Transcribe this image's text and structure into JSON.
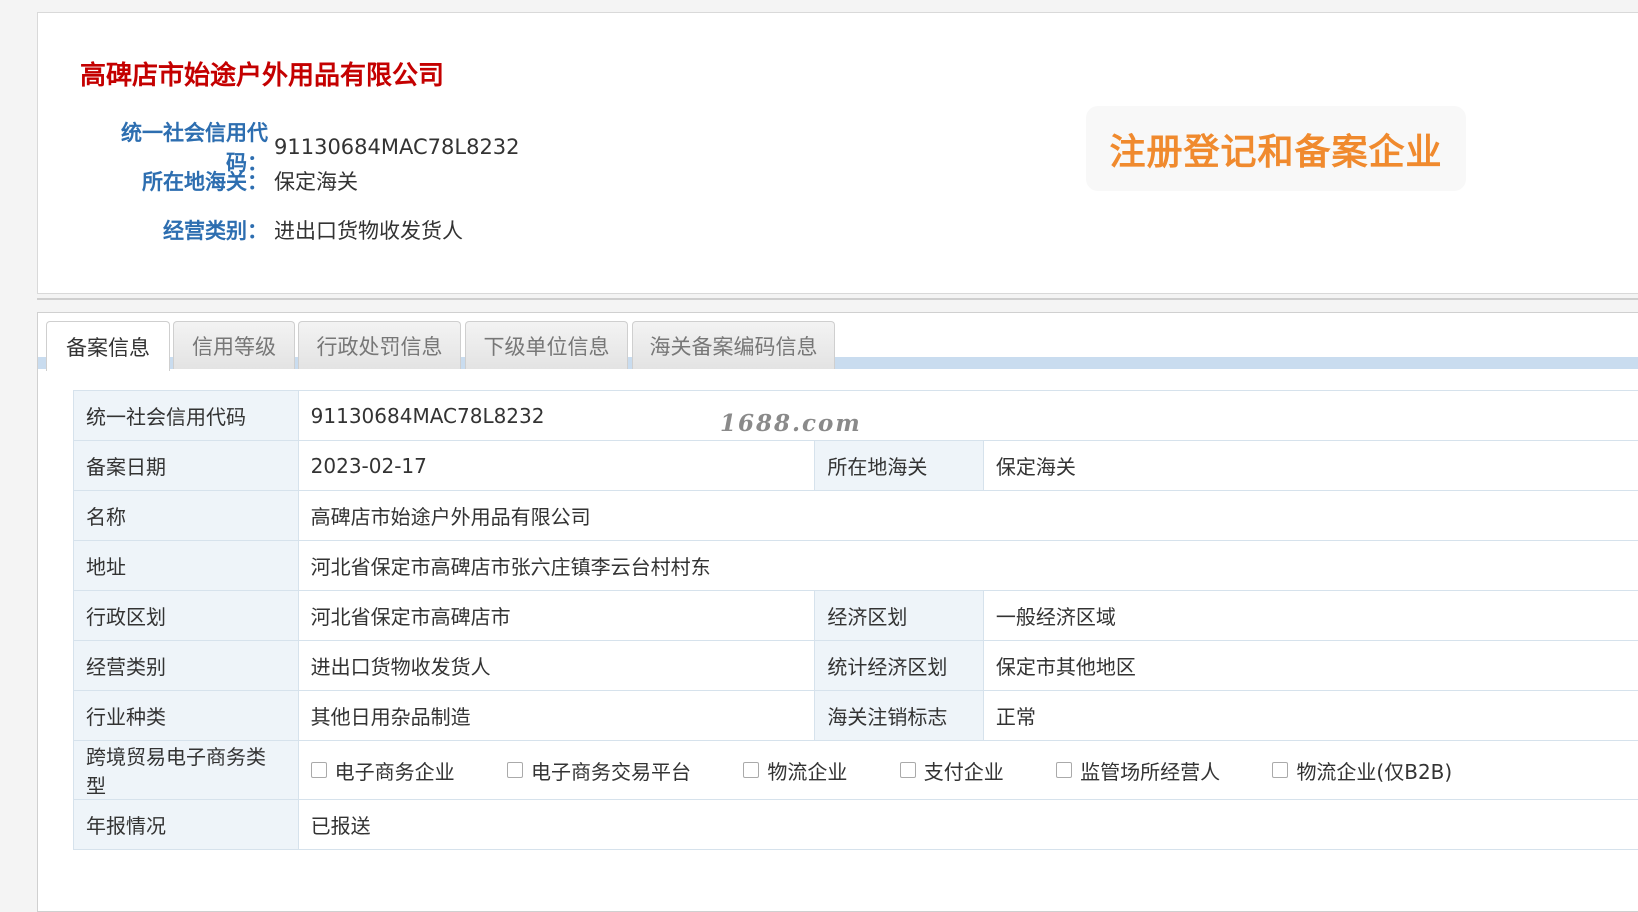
{
  "header": {
    "company_name": "高碑店市始途户外用品有限公司",
    "fields": [
      {
        "label": "统一社会信用代码：",
        "value": "91130684MAC78L8232"
      },
      {
        "label": "所在地海关：",
        "value": "保定海关"
      },
      {
        "label": "经营类别：",
        "value": "进出口货物收发货人"
      }
    ],
    "badge": "注册登记和备案企业"
  },
  "tabs": [
    "备案信息",
    "信用等级",
    "行政处罚信息",
    "下级单位信息",
    "海关备案编码信息"
  ],
  "active_tab": "备案信息",
  "watermark": "1688.com",
  "table": {
    "credit_code_label": "统一社会信用代码",
    "credit_code": "91130684MAC78L8232",
    "record_date_label": "备案日期",
    "record_date": "2023-02-17",
    "customs_label": "所在地海关",
    "customs": "保定海关",
    "name_label": "名称",
    "name": "高碑店市始途户外用品有限公司",
    "address_label": "地址",
    "address": "河北省保定市高碑店市张六庄镇李云台村村东",
    "admin_region_label": "行政区划",
    "admin_region": "河北省保定市高碑店市",
    "econ_region_label": "经济区划",
    "econ_region": "一般经济区域",
    "business_type_label": "经营类别",
    "business_type": "进出口货物收发货人",
    "stat_region_label": "统计经济区划",
    "stat_region": "保定市其他地区",
    "industry_label": "行业种类",
    "industry": "其他日用杂品制造",
    "cancel_flag_label": "海关注销标志",
    "cancel_flag": "正常",
    "ecommerce_label": "跨境贸易电子商务类型",
    "ecommerce_options": [
      "电子商务企业",
      "电子商务交易平台",
      "物流企业",
      "支付企业",
      "监管场所经营人",
      "物流企业(仅B2B)"
    ],
    "annual_report_label": "年报情况",
    "annual_report": "已报送"
  }
}
